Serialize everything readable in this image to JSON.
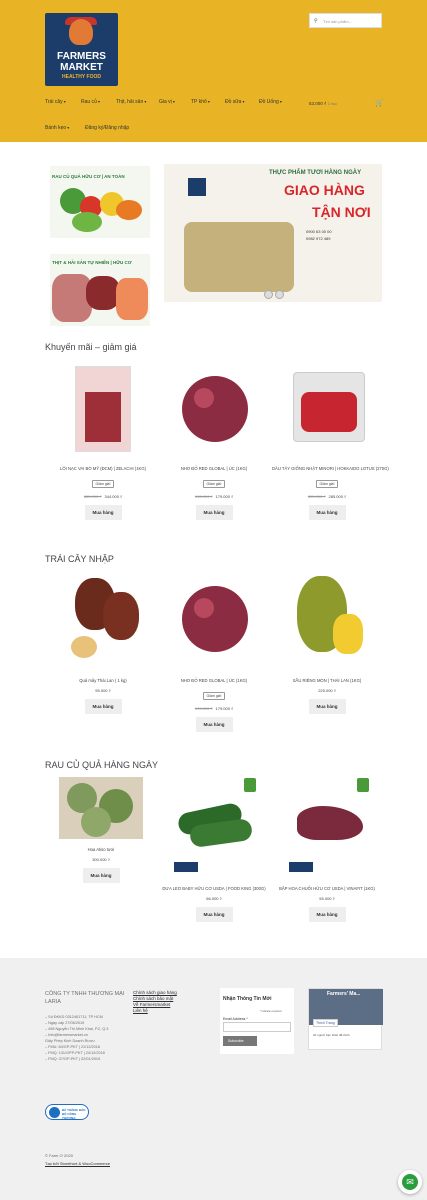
{
  "header": {
    "logo_line1": "FARMERS",
    "logo_line2": "MARKET",
    "logo_tag": "HEALTHY FOOD",
    "search_placeholder": "Tìm sản phẩm…",
    "cart_amount": "53.000 ₫",
    "cart_count": "1 mục",
    "nav": [
      "Trái cây",
      "Rau củ",
      "Thịt, hải sản",
      "Gia vị",
      "TP khô",
      "Đồ sữa",
      "Đồ Uống",
      "Bánh kẹo",
      "Đăng ký/Đăng nhập"
    ]
  },
  "side_banners": [
    {
      "title": "RAU CỦ QUẢ HỮU CƠ | AN TOÀN"
    },
    {
      "title": "THỊT & HẢI SẢN TỰ NHIÊN | HỮU CƠ"
    }
  ],
  "main_banner": {
    "tagline": "THỰC PHẨM TƯƠI HÀNG NGÀY",
    "headline1": "GIAO HÀNG",
    "headline2": "TẬN NƠI",
    "contacts": [
      "0900 63 00 00",
      "0982 972 489"
    ]
  },
  "sections": [
    {
      "title": "Khuyến mãi – giảm giá",
      "products": [
        {
          "name": "LÕI NẠC VAI BÒ MỸ (ĐCM) | ZELACHI (1KG)",
          "badge": "Giảm giá!",
          "old_price": "385.000 ₫",
          "price": "344.000 ₫",
          "button": "Mua hàng"
        },
        {
          "name": "NHO ĐỎ RED GLOBAL | ÚC (1KG)",
          "badge": "Giảm giá!",
          "old_price": "195.000 ₫",
          "price": "179.000 ₫",
          "button": "Mua hàng"
        },
        {
          "name": "DÂU TÂY GIỐNG NHẬT MINORI | HOKKAIDO LOTUS (270G)",
          "badge": "Giảm giá!",
          "old_price": "305.000 ₫",
          "price": "285.000 ₫",
          "button": "Mua hàng"
        }
      ]
    },
    {
      "title": "TRÁI CÂY NHẬP",
      "products": [
        {
          "name": "Quả mây Thái Lan ( 1 kg)",
          "badge": "",
          "old_price": "",
          "price": "95.000 ₫",
          "button": "Mua hàng"
        },
        {
          "name": "NHO ĐỎ RED GLOBAL | ÚC (1KG)",
          "badge": "Giảm giá!",
          "old_price": "195.000 ₫",
          "price": "179.000 ₫",
          "button": "Mua hàng"
        },
        {
          "name": "SẦU RIÊNG MON | THÁI LAN (1KG)",
          "badge": "",
          "old_price": "",
          "price": "225.000 ₫",
          "button": "Mua hàng"
        }
      ]
    },
    {
      "title": "RAU CỦ QUẢ HÀNG NGÀY",
      "products": [
        {
          "name": "Hoa Atiso tươi",
          "badge": "",
          "old_price": "",
          "price": "300.000 ₫",
          "button": "Mua hàng"
        },
        {
          "name": "DƯA LEO BABY HỮU CƠ USDA | FOOD KING (300G)",
          "badge": "",
          "old_price": "",
          "price": "66.000 ₫",
          "button": "Mua hàng"
        },
        {
          "name": "BẮP HOA CHUỐI HỮU CƠ USDA | VINAFIT (1KG)",
          "badge": "",
          "old_price": "",
          "price": "55.000 ₫",
          "button": "Mua hàng"
        }
      ]
    }
  ],
  "footer": {
    "company": "CÔNG TY TNHH THƯƠNG MẠI LARIA",
    "address_lines": [
      "– Số ĐKKD 0312461711, TP HCM",
      "– Ngày cấp 27/06/2019",
      "– 498 Nguyễn Thị Minh Khai, P.2, Q.3",
      "– Info@farmersmarket.vn",
      "Giấy Phép Kinh Doanh Rượu",
      "– FMU: 84/GP-PKT | 21/12/2018",
      "– FMQ: 131/GPP-PKT | 24/12/2018",
      "– FMQ: 37/GP-PKT | 02/01/2019"
    ],
    "links": [
      "Chính sách giao hàng",
      "Chính sách bảo mật",
      "Về Farmersmarket",
      "Liên hệ"
    ],
    "newsletter_title": "Nhận Thông Tin Mới",
    "newsletter_required": "* indicates required",
    "newsletter_label": "Email Address *",
    "newsletter_button": "Subscribe",
    "fb_page": "Farmers' Ma...",
    "fb_like": "Thích Trang",
    "fb_post": "20 người bạn khác đã thích",
    "badge_text": "ĐÃ THÔNG BÁO BỘ CÔNG THƯƠNG",
    "copyright": "© Farm Ơ 2020",
    "credit": "Tạo bởi Storefront & WooCommerce"
  }
}
